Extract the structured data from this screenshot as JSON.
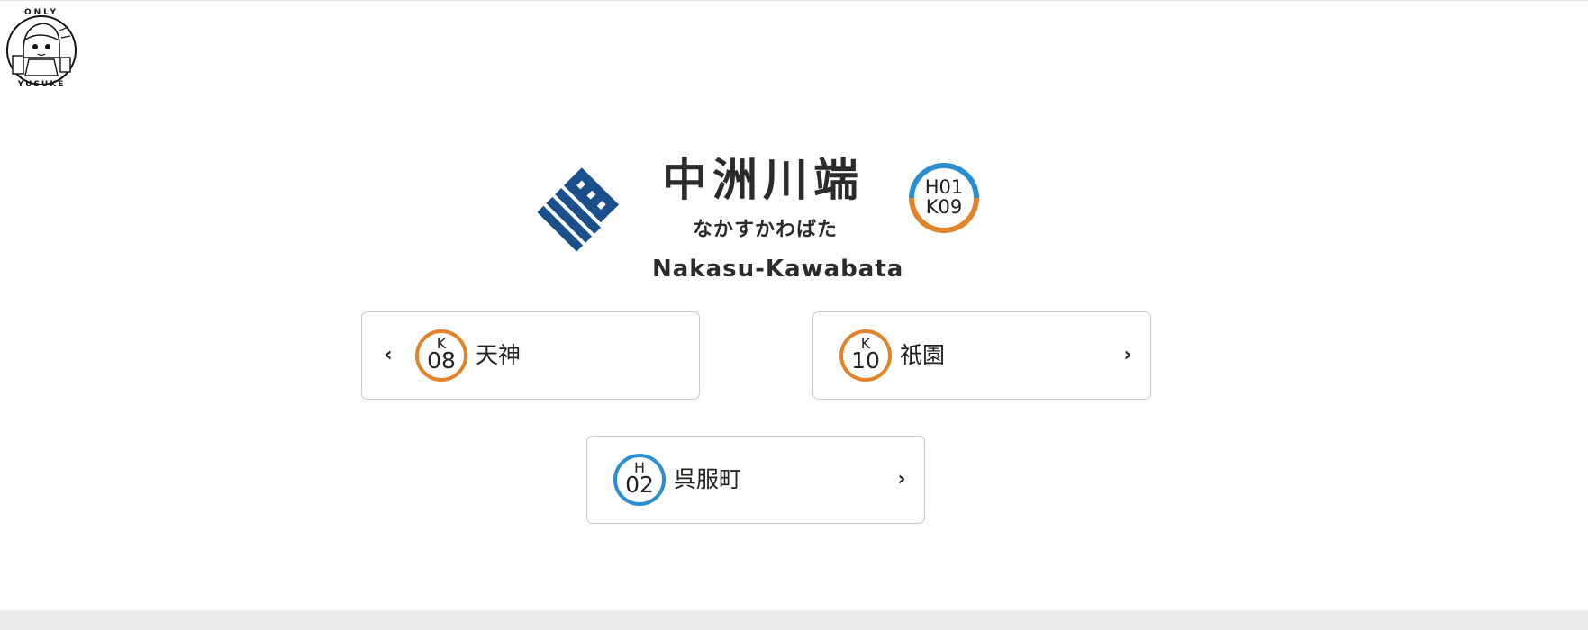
{
  "watermark": {
    "top_text": "ONLY",
    "bottom_text": "YUSUKE"
  },
  "station": {
    "name_kanji": "中洲川端",
    "name_kana": "なかすかわばた",
    "name_romaji": "Nakasu-Kawabata",
    "codes": [
      "H01",
      "K09"
    ],
    "code_colors": {
      "hakozaki_line": "#2a8fd0",
      "kuko_line": "#e2832a"
    },
    "logo_color": "#1a4f8b"
  },
  "navigation": {
    "previous": {
      "arrow_icon": "chevron-left-icon",
      "line_letter": "K",
      "number": "08",
      "name": "天神",
      "ring_color": "#e2832a"
    },
    "next": {
      "arrow_icon": "chevron-right-icon",
      "line_letter": "K",
      "number": "10",
      "name": "祇園",
      "ring_color": "#e2832a"
    },
    "transfer": {
      "arrow_icon": "chevron-right-icon",
      "line_letter": "H",
      "number": "02",
      "name": "呉服町",
      "ring_color": "#2a8fd0"
    }
  }
}
